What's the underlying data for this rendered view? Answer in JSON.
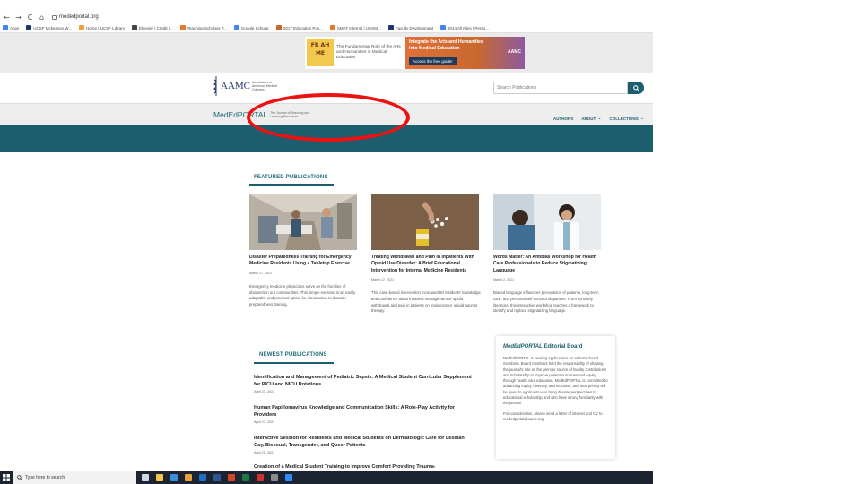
{
  "browser": {
    "nav": {
      "back": "←",
      "forward": "→",
      "reload": "C",
      "home": "⌂"
    },
    "url": "mededportal.org",
    "bookmarks": [
      {
        "label": "Apps",
        "color": "#4285f4"
      },
      {
        "label": "UCSF Mckesson W...",
        "color": "#1b3a6b"
      },
      {
        "label": "Home | UCSF Library",
        "color": "#e8a33a"
      },
      {
        "label": "Elsevier | Credit i...",
        "color": "#444444"
      },
      {
        "label": "Teaching Scholars P...",
        "color": "#e27a2e"
      },
      {
        "label": "Google Scholar",
        "color": "#4285f4"
      },
      {
        "label": "2017 Education Pos...",
        "color": "#c9692f"
      },
      {
        "label": "SMAT Internal | USSM...",
        "color": "#e27a2e"
      },
      {
        "label": "Faculty Development",
        "color": "#1b3a6b"
      },
      {
        "label": "2014 All Files | Perso...",
        "color": "#4285f4"
      }
    ]
  },
  "banner": {
    "left_text": "The Fundamental Role of the Arts and Humanities in Medical Education",
    "frahme": "FR AH ME",
    "title": "Integrate the Arts and Humanities into Medical Education",
    "cta": "Access the free guide!",
    "logo": "AAMC"
  },
  "header": {
    "logo": "AAMC",
    "logo_sub": "Association of American Medical Colleges",
    "search_placeholder": "Search Publications",
    "brand": "MedEdPORTAL",
    "brand_sub": "The Journal of Teaching and Learning Resources",
    "nav": [
      {
        "label": "AUTHORS",
        "chevron": false
      },
      {
        "label": "ABOUT",
        "chevron": true
      },
      {
        "label": "COLLECTIONS",
        "chevron": true
      }
    ]
  },
  "featured": {
    "heading": "FEATURED PUBLICATIONS",
    "cards": [
      {
        "title": "Disaster Preparedness Training for Emergency Medicine Residents Using a Tabletop Exercise",
        "date": "March 17, 2021",
        "desc": "Emergency medicine physicians serve on the frontline of disasters in our communities. This simple exercise is an easily adaptable and practical option for introduction to disaster preparedness training."
      },
      {
        "title": "Treating Withdrawal and Pain in Inpatients With Opioid Use Disorder: A Brief Educational Intervention for Internal Medicine Residents",
        "date": "March 17, 2021",
        "desc": "This case-based intervention increased IM residents' knowledge and confidence about inpatient management of opioid withdrawal and pain in patients on maintenance opioid agonist therapy."
      },
      {
        "title": "Words Matter: An Antibias Workshop for Health Care Professionals to Reduce Stigmatizing Language",
        "date": "March 2, 2021",
        "desc": "Biased language influences perceptions of patients, long-term care, and personal self-concept disparities. From scholarly literature, this interactive workshop teaches a framework to identify and replace stigmatizing language."
      }
    ]
  },
  "newest": {
    "heading": "NEWEST PUBLICATIONS",
    "items": [
      {
        "title": "Identification and Management of Pediatric Sepsis: A Medical Student Curricular Supplement for PICU and NICU Rotations",
        "date": "April 23, 2021"
      },
      {
        "title": "Human Papillomavirus Knowledge and Communication Skills: A Role-Play Activity for Providers",
        "date": "April 23, 2021"
      },
      {
        "title": "Interactive Session for Residents and Medical Students on Dermatologic Care for Lesbian, Gay, Bisexual, Transgender, and Queer Patients",
        "date": "April 21, 2021"
      },
      {
        "title": "Creation of a Medical Student Training to Improve Comfort Providing Trauma-",
        "date": ""
      }
    ]
  },
  "board": {
    "title_em": "MedEdPORTAL",
    "title_rest": " Editorial Board",
    "text": "MedEdPORTAL is seeking applications for editorial board members. Board members hold the responsibility of shaping the journal's role as the premier source of faculty contributions and scholarship to improve patient outcomes and equity through health care education. MedEdPORTAL is committed to advancing equity, diversity, and inclusion, and thus priority will be given to applicants who bring diverse perspectives to educational scholarship and who have strong familiarity with the journal.",
    "contact": "For consideration, please send a letter of interest and CV to mededportal@aamc.org."
  },
  "taskbar": {
    "search_placeholder": "Type here to search",
    "apps": [
      {
        "name": "task-view-icon",
        "color": "#cfd8e3"
      },
      {
        "name": "file-explorer-icon",
        "color": "#f2c94c"
      },
      {
        "name": "internet-explorer-icon",
        "color": "#3b8fd9"
      },
      {
        "name": "chrome-icon",
        "color": "#e9a23b"
      },
      {
        "name": "outlook-icon",
        "color": "#1f6fc5"
      },
      {
        "name": "word-icon",
        "color": "#2b5797"
      },
      {
        "name": "powerpoint-icon",
        "color": "#d24726"
      },
      {
        "name": "excel-icon",
        "color": "#1d7a43"
      },
      {
        "name": "acrobat-icon",
        "color": "#d3322b"
      },
      {
        "name": "snipping-icon",
        "color": "#8a8a8a"
      },
      {
        "name": "zoom-icon",
        "color": "#2d8cff"
      }
    ]
  },
  "colors": {
    "teal": "#1c5e6e",
    "annotation": "#ee1111"
  }
}
